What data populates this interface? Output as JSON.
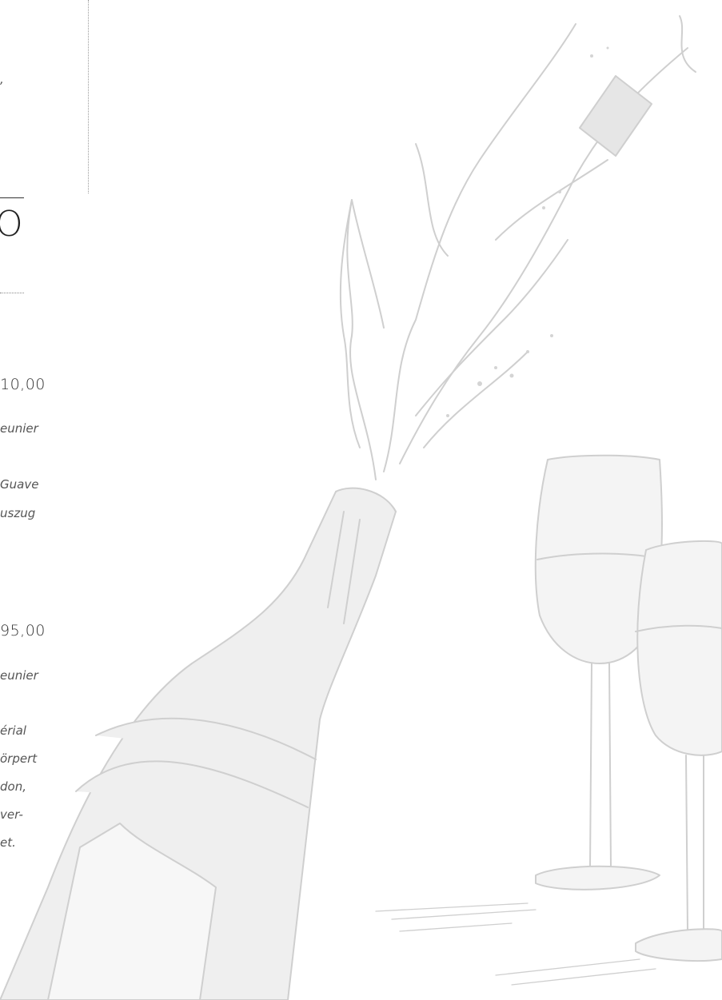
{
  "top_fragment": ",",
  "heading_fragment": "O",
  "items": [
    {
      "price": "10,00",
      "lines": [
        "eunier",
        "Guave",
        "uszug"
      ]
    },
    {
      "price": "95,00",
      "lines": [
        "eunier",
        "érial",
        "örpert",
        "don,",
        "ver-",
        "et."
      ]
    }
  ]
}
